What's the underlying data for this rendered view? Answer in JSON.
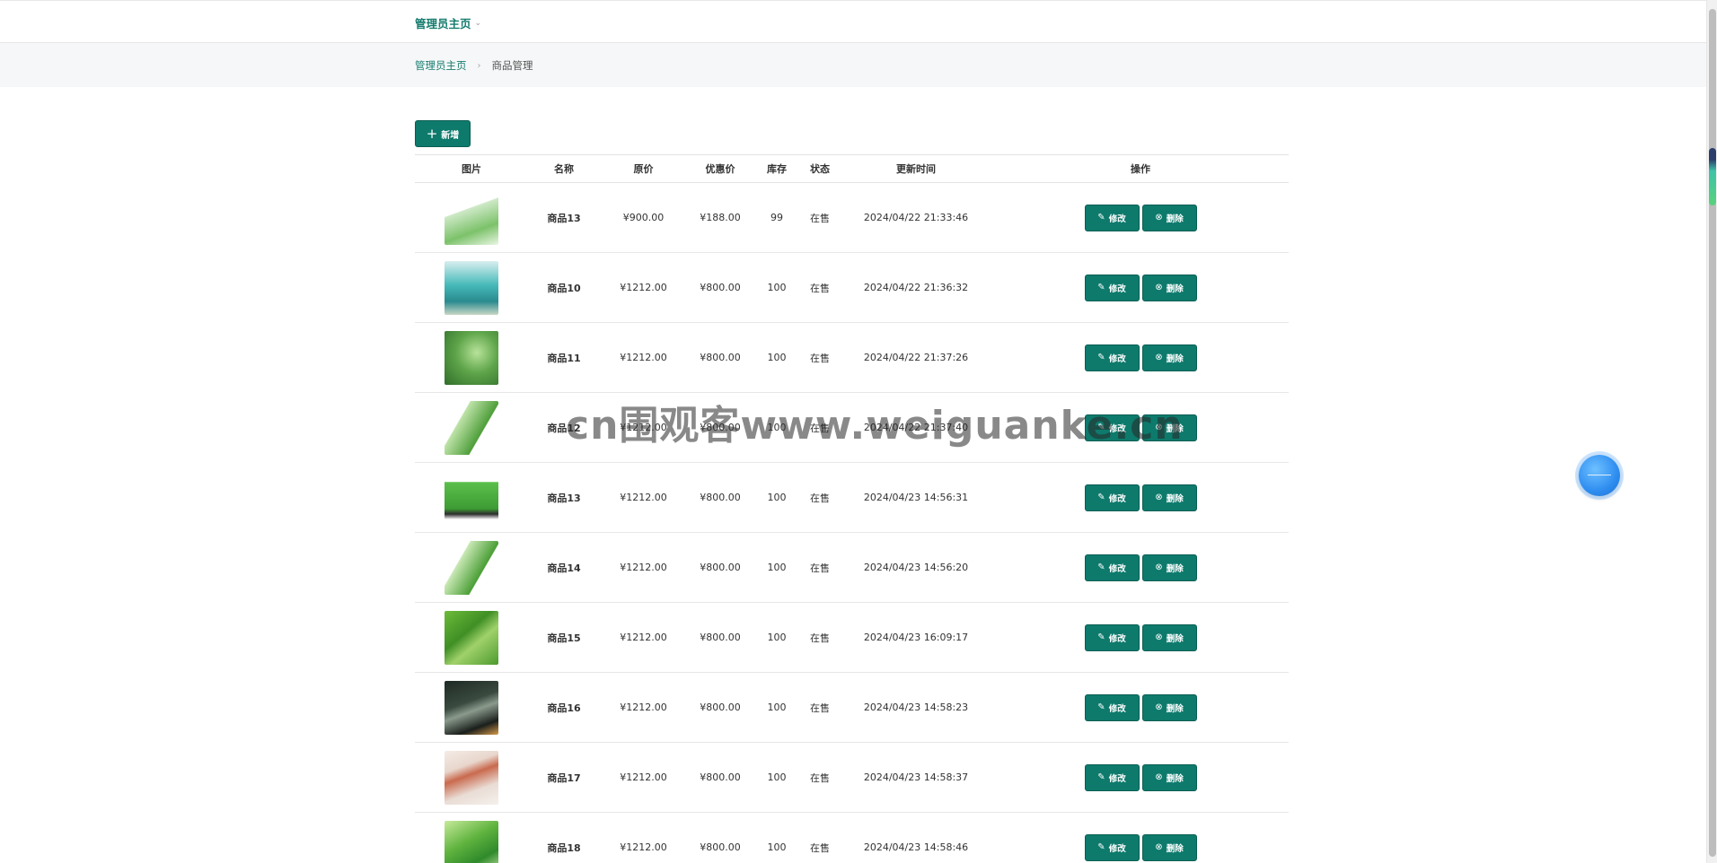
{
  "header": {
    "admin_menu": "管理员主页"
  },
  "breadcrumb": {
    "home": "管理员主页",
    "separator": "›",
    "current": "商品管理"
  },
  "toolbar": {
    "add_label": "新增"
  },
  "table": {
    "columns": [
      "图片",
      "名称",
      "原价",
      "优惠价",
      "库存",
      "状态",
      "更新时间",
      "操作"
    ],
    "rows": [
      {
        "name": "商品13",
        "price": "¥900.00",
        "discount": "¥188.00",
        "stock": "99",
        "status": "在售",
        "updated": "2024/04/22 21:33:46",
        "image": "tea-cans-white-green"
      },
      {
        "name": "商品10",
        "price": "¥1212.00",
        "discount": "¥800.00",
        "stock": "100",
        "status": "在售",
        "updated": "2024/04/22 21:36:32",
        "image": "tea-cans-teal"
      },
      {
        "name": "商品11",
        "price": "¥1212.00",
        "discount": "¥800.00",
        "stock": "100",
        "status": "在售",
        "updated": "2024/04/22 21:37:26",
        "image": "tea-leaves-cup"
      },
      {
        "name": "商品12",
        "price": "¥1212.00",
        "discount": "¥800.00",
        "stock": "100",
        "status": "在售",
        "updated": "2024/04/22 21:37:40",
        "image": "tea-box-glass"
      },
      {
        "name": "商品13",
        "price": "¥1212.00",
        "discount": "¥800.00",
        "stock": "100",
        "status": "在售",
        "updated": "2024/04/23 14:56:31",
        "image": "tea-green-box"
      },
      {
        "name": "商品14",
        "price": "¥1212.00",
        "discount": "¥800.00",
        "stock": "100",
        "status": "在售",
        "updated": "2024/04/23 14:56:20",
        "image": "tea-box-glass"
      },
      {
        "name": "商品15",
        "price": "¥1212.00",
        "discount": "¥800.00",
        "stock": "100",
        "status": "在售",
        "updated": "2024/04/23 16:09:17",
        "image": "tea-field-can"
      },
      {
        "name": "商品16",
        "price": "¥1212.00",
        "discount": "¥800.00",
        "stock": "100",
        "status": "在售",
        "updated": "2024/04/23 14:58:23",
        "image": "tea-dark-set"
      },
      {
        "name": "商品17",
        "price": "¥1212.00",
        "discount": "¥800.00",
        "stock": "100",
        "status": "在售",
        "updated": "2024/04/23 14:58:37",
        "image": "tea-red-box"
      },
      {
        "name": "商品18",
        "price": "¥1212.00",
        "discount": "¥800.00",
        "stock": "100",
        "status": "在售",
        "updated": "2024/04/23 14:58:46",
        "image": "tea-green-pack"
      }
    ],
    "edit_label": "修改",
    "delete_label": "删除"
  },
  "watermark": "cn围观客www.weiguanke.cn",
  "icons": {
    "edit": "edit-icon",
    "delete": "delete-icon",
    "add": "plus-icon",
    "menu": "chevron-down-icon"
  },
  "colors": {
    "primary": "#0d7a6c",
    "link": "#157c6e",
    "breadcrumb_bg": "#f5f7f8"
  }
}
